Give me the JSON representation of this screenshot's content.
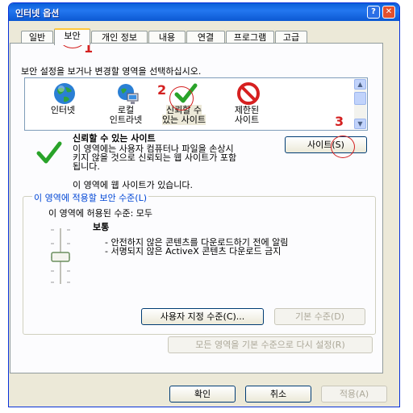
{
  "window": {
    "title": "인터넷 옵션",
    "help_btn": "?",
    "close_btn": "✕"
  },
  "tabs": [
    "일반",
    "보안",
    "개인 정보",
    "내용",
    "연결",
    "프로그램",
    "고급"
  ],
  "zones_label": "보안 설정을 보거나 변경할 영역을 선택하십시오.",
  "zones": [
    {
      "label1": "인터넷",
      "label2": "",
      "icon": "globe-icon"
    },
    {
      "label1": "로컬",
      "label2": "인트라넷",
      "icon": "intranet-icon"
    },
    {
      "label1": "신뢰할 수",
      "label2": "있는 사이트",
      "icon": "checkmark-icon"
    },
    {
      "label1": "제한된",
      "label2": "사이트",
      "icon": "restricted-icon"
    }
  ],
  "zone_info": {
    "title": "신뢰할 수 있는 사이트",
    "desc_lines": [
      "이 영역에는 사용자 컴퓨터나 파일을 손상시",
      "키지 않을 것으로 신뢰되는 웹 사이트가 포함",
      "됩니다."
    ],
    "note": "이 영역에 웹 사이트가 있습니다.",
    "sites_button": "사이트(S)"
  },
  "security_level": {
    "group_title": "이 영역에 적용할 보안 수준(L)",
    "allowed": "이 영역에 허용된 수준: 모두",
    "level_name": "보통",
    "bullets": [
      "- 안전하지 않은 콘텐츠를 다운로드하기 전에 알림",
      "- 서명되지 않은 ActiveX 콘텐츠 다운로드 금지"
    ],
    "custom_button": "사용자 지정 수준(C)...",
    "default_button": "기본 수준(D)",
    "reset_all_button": "모든 영역을 기본 수준으로 다시 설정(R)"
  },
  "footer": {
    "ok": "확인",
    "cancel": "취소",
    "apply": "적용(A)"
  },
  "annotations": [
    "1",
    "2",
    "3"
  ]
}
